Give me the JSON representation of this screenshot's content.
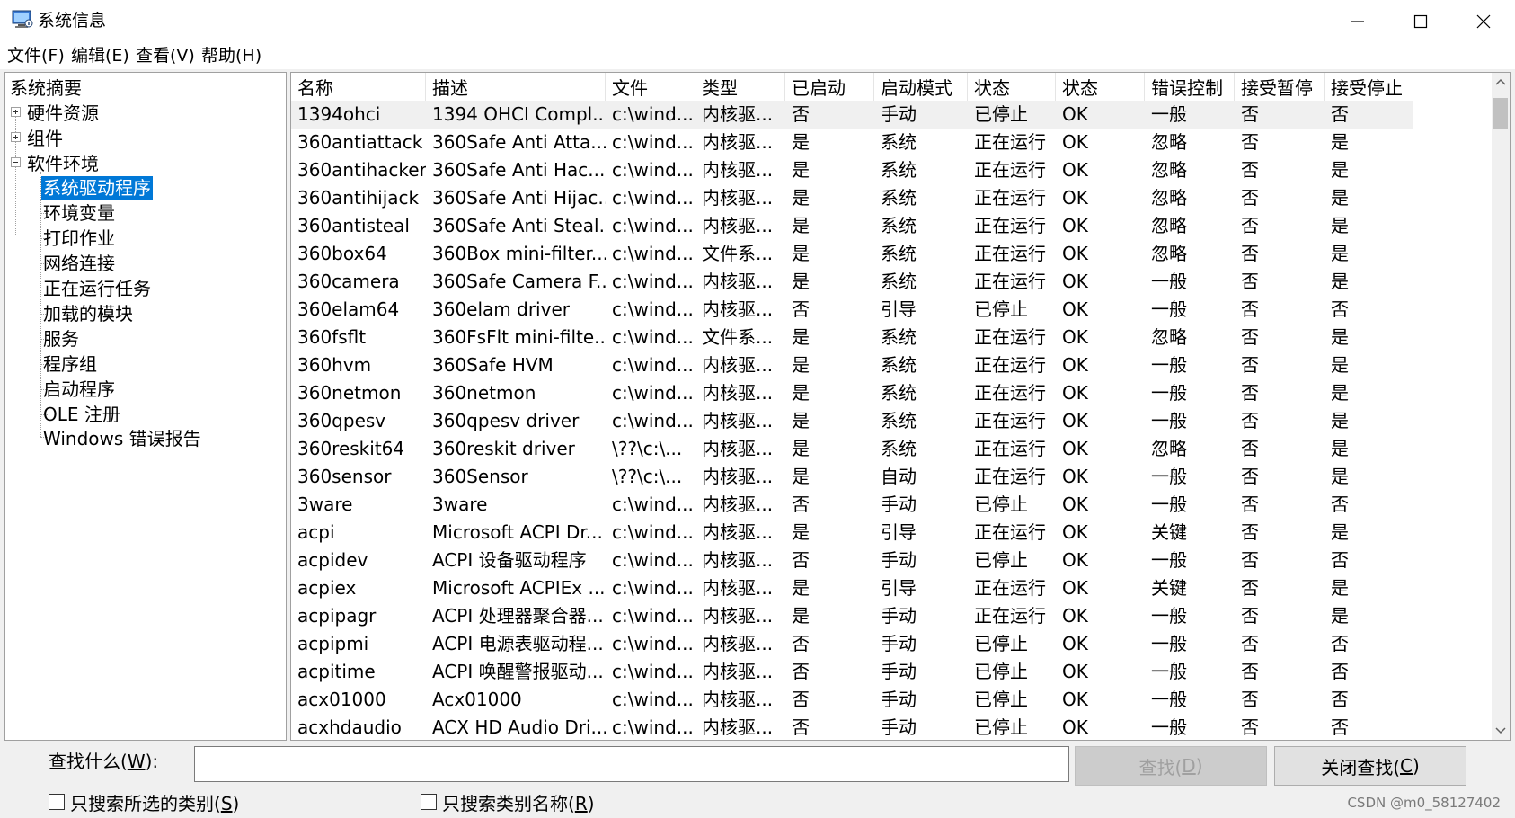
{
  "window": {
    "title": "系统信息",
    "icon": "monitor-info-icon"
  },
  "menu": [
    "文件(F)",
    "编辑(E)",
    "查看(V)",
    "帮助(H)"
  ],
  "tree": {
    "root": "系统摘要",
    "nodes": [
      "硬件资源",
      "组件",
      "软件环境"
    ],
    "children": [
      "系统驱动程序",
      "环境变量",
      "打印作业",
      "网络连接",
      "正在运行任务",
      "加载的模块",
      "服务",
      "程序组",
      "启动程序",
      "OLE 注册",
      "Windows 错误报告"
    ],
    "selected": "系统驱动程序"
  },
  "table": {
    "headers": [
      "名称",
      "描述",
      "文件",
      "类型",
      "已启动",
      "启动模式",
      "状态",
      "状态",
      "错误控制",
      "接受暂停",
      "接受停止"
    ],
    "rows": [
      [
        "1394ohci",
        "1394 OHCI Compl...",
        "c:\\wind...",
        "内核驱...",
        "否",
        "手动",
        "已停止",
        "OK",
        "一般",
        "否",
        "否"
      ],
      [
        "360antiattack",
        "360Safe Anti Atta...",
        "c:\\wind...",
        "内核驱...",
        "是",
        "系统",
        "正在运行",
        "OK",
        "忽略",
        "否",
        "是"
      ],
      [
        "360antihacker",
        "360Safe Anti Hac...",
        "c:\\wind...",
        "内核驱...",
        "是",
        "系统",
        "正在运行",
        "OK",
        "忽略",
        "否",
        "是"
      ],
      [
        "360antihijack",
        "360Safe Anti Hijac...",
        "c:\\wind...",
        "内核驱...",
        "是",
        "系统",
        "正在运行",
        "OK",
        "忽略",
        "否",
        "是"
      ],
      [
        "360antisteal",
        "360Safe Anti Steal...",
        "c:\\wind...",
        "内核驱...",
        "是",
        "系统",
        "正在运行",
        "OK",
        "忽略",
        "否",
        "是"
      ],
      [
        "360box64",
        "360Box mini-filter...",
        "c:\\wind...",
        "文件系...",
        "是",
        "系统",
        "正在运行",
        "OK",
        "忽略",
        "否",
        "是"
      ],
      [
        "360camera",
        "360Safe Camera F...",
        "c:\\wind...",
        "内核驱...",
        "是",
        "系统",
        "正在运行",
        "OK",
        "一般",
        "否",
        "是"
      ],
      [
        "360elam64",
        "360elam driver",
        "c:\\wind...",
        "内核驱...",
        "否",
        "引导",
        "已停止",
        "OK",
        "一般",
        "否",
        "否"
      ],
      [
        "360fsflt",
        "360FsFlt mini-filte...",
        "c:\\wind...",
        "文件系...",
        "是",
        "系统",
        "正在运行",
        "OK",
        "忽略",
        "否",
        "是"
      ],
      [
        "360hvm",
        "360Safe HVM",
        "c:\\wind...",
        "内核驱...",
        "是",
        "系统",
        "正在运行",
        "OK",
        "一般",
        "否",
        "是"
      ],
      [
        "360netmon",
        "360netmon",
        "c:\\wind...",
        "内核驱...",
        "是",
        "系统",
        "正在运行",
        "OK",
        "一般",
        "否",
        "是"
      ],
      [
        "360qpesv",
        "360qpesv driver",
        "c:\\wind...",
        "内核驱...",
        "是",
        "系统",
        "正在运行",
        "OK",
        "一般",
        "否",
        "是"
      ],
      [
        "360reskit64",
        "360reskit driver",
        "\\??\\c:\\...",
        "内核驱...",
        "是",
        "系统",
        "正在运行",
        "OK",
        "忽略",
        "否",
        "是"
      ],
      [
        "360sensor",
        "360Sensor",
        "\\??\\c:\\...",
        "内核驱...",
        "是",
        "自动",
        "正在运行",
        "OK",
        "一般",
        "否",
        "是"
      ],
      [
        "3ware",
        "3ware",
        "c:\\wind...",
        "内核驱...",
        "否",
        "手动",
        "已停止",
        "OK",
        "一般",
        "否",
        "否"
      ],
      [
        "acpi",
        "Microsoft ACPI Dr...",
        "c:\\wind...",
        "内核驱...",
        "是",
        "引导",
        "正在运行",
        "OK",
        "关键",
        "否",
        "是"
      ],
      [
        "acpidev",
        "ACPI 设备驱动程序",
        "c:\\wind...",
        "内核驱...",
        "否",
        "手动",
        "已停止",
        "OK",
        "一般",
        "否",
        "否"
      ],
      [
        "acpiex",
        "Microsoft ACPIEx ...",
        "c:\\wind...",
        "内核驱...",
        "是",
        "引导",
        "正在运行",
        "OK",
        "关键",
        "否",
        "是"
      ],
      [
        "acpipagr",
        "ACPI 处理器聚合器...",
        "c:\\wind...",
        "内核驱...",
        "是",
        "手动",
        "正在运行",
        "OK",
        "一般",
        "否",
        "是"
      ],
      [
        "acpipmi",
        "ACPI 电源表驱动程...",
        "c:\\wind...",
        "内核驱...",
        "否",
        "手动",
        "已停止",
        "OK",
        "一般",
        "否",
        "否"
      ],
      [
        "acpitime",
        "ACPI 唤醒警报驱动...",
        "c:\\wind...",
        "内核驱...",
        "否",
        "手动",
        "已停止",
        "OK",
        "一般",
        "否",
        "否"
      ],
      [
        "acx01000",
        "Acx01000",
        "c:\\wind...",
        "内核驱...",
        "否",
        "手动",
        "已停止",
        "OK",
        "一般",
        "否",
        "否"
      ],
      [
        "acxhdaudio",
        "ACX HD Audio Dri...",
        "c:\\wind...",
        "内核驱...",
        "否",
        "手动",
        "已停止",
        "OK",
        "一般",
        "否",
        "否"
      ]
    ]
  },
  "find": {
    "label_prefix": "查找什么(",
    "label_key": "W",
    "label_suffix": "):",
    "value": "",
    "find_prefix": "查找(",
    "find_key": "D",
    "find_suffix": ")",
    "close_prefix": "关闭查找(",
    "close_key": "C",
    "close_suffix": ")",
    "check1_prefix": "只搜索所选的类别(",
    "check1_key": "S",
    "check1_suffix": ")",
    "check2_prefix": "只搜索类别名称(",
    "check2_key": "R",
    "check2_suffix": ")"
  },
  "watermark": "CSDN @m0_58127402",
  "colors": {
    "selection": "#0078d7",
    "chrome": "#f0f0f0"
  }
}
